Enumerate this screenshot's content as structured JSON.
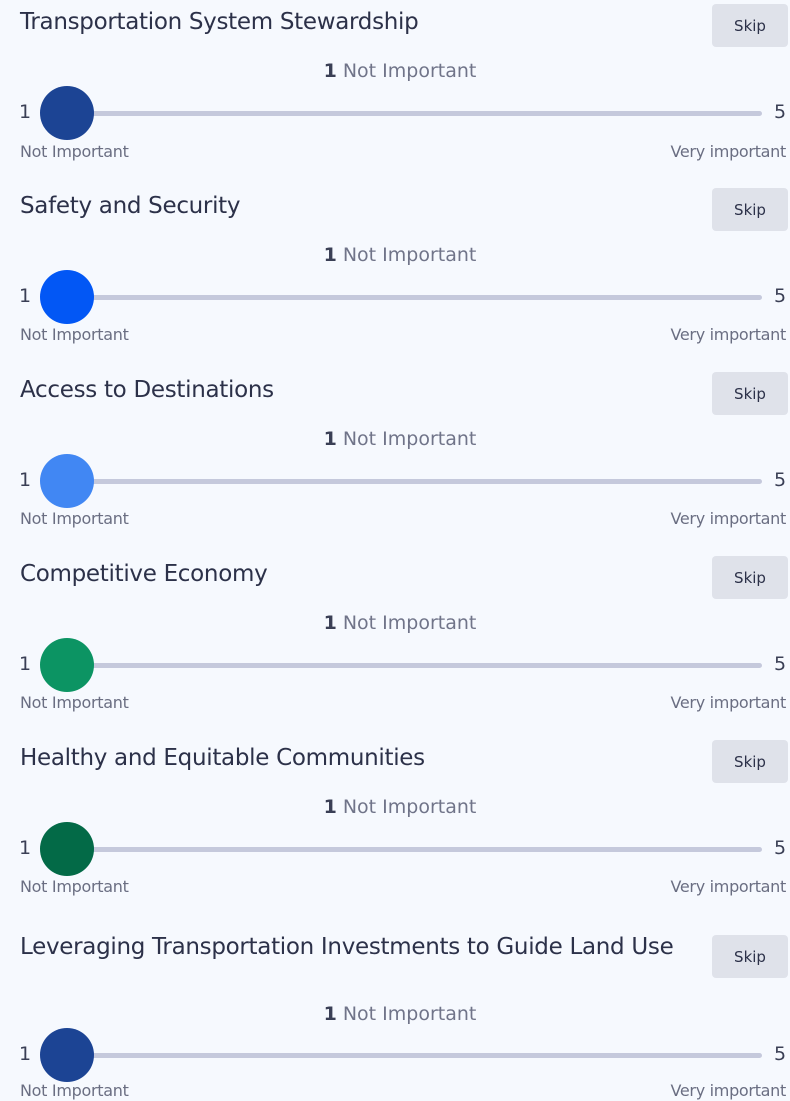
{
  "questions": [
    {
      "title": "Transportation System Stewardship",
      "skip_label": "Skip",
      "value": "1",
      "value_text": "Not Important",
      "min": "1",
      "max": "5",
      "min_label": "Not Important",
      "max_label": "Very important",
      "thumb_color": "#1c4494"
    },
    {
      "title": "Safety and Security",
      "skip_label": "Skip",
      "value": "1",
      "value_text": "Not Important",
      "min": "1",
      "max": "5",
      "min_label": "Not Important",
      "max_label": "Very important",
      "thumb_color": "#0257f5"
    },
    {
      "title": "Access to Destinations",
      "skip_label": "Skip",
      "value": "1",
      "value_text": "Not Important",
      "min": "1",
      "max": "5",
      "min_label": "Not Important",
      "max_label": "Very important",
      "thumb_color": "#4187f3"
    },
    {
      "title": "Competitive Economy",
      "skip_label": "Skip",
      "value": "1",
      "value_text": "Not Important",
      "min": "1",
      "max": "5",
      "min_label": "Not Important",
      "max_label": "Very important",
      "thumb_color": "#0c9463"
    },
    {
      "title": "Healthy and Equitable Communities",
      "skip_label": "Skip",
      "value": "1",
      "value_text": "Not Important",
      "min": "1",
      "max": "5",
      "min_label": "Not Important",
      "max_label": "Very important",
      "thumb_color": "#036a47"
    },
    {
      "title": "Leveraging Transportation Investments to Guide Land Use",
      "skip_label": "Skip",
      "value": "1",
      "value_text": "Not Important",
      "min": "1",
      "max": "5",
      "min_label": "Not Important",
      "max_label": "Very important",
      "thumb_color": "#1c4494"
    }
  ]
}
